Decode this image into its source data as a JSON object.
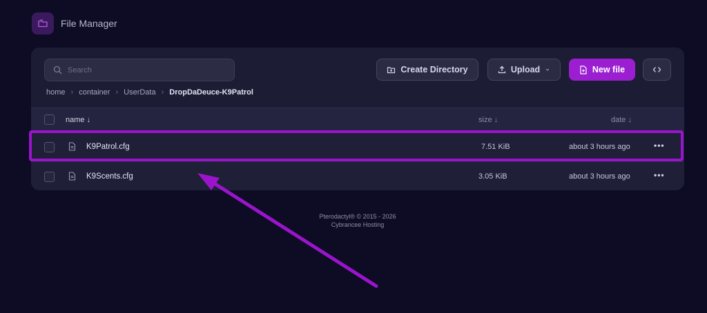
{
  "header": {
    "title": "File Manager",
    "icon": "folder-icon"
  },
  "search": {
    "placeholder": "Search",
    "value": ""
  },
  "toolbar": {
    "create_directory_label": "Create Directory",
    "upload_label": "Upload",
    "new_file_label": "New file"
  },
  "breadcrumb": {
    "items": [
      "home",
      "container",
      "UserData"
    ],
    "current": "DropDaDeuce-K9Patrol"
  },
  "table": {
    "columns": {
      "name": "name ↓",
      "size": "size ↓",
      "date": "date ↓"
    },
    "rows": [
      {
        "name": "K9Patrol.cfg",
        "size": "7.51 KiB",
        "date": "about 3 hours ago"
      },
      {
        "name": "K9Scents.cfg",
        "size": "3.05 KiB",
        "date": "about 3 hours ago"
      }
    ]
  },
  "footer": {
    "line1": "Pterodactyl® © 2015 - 2026",
    "line2": "Cybrancee Hosting"
  },
  "colors": {
    "accent": "#9b1fd1",
    "highlight": "#9a14cc",
    "background": "#0d0c24",
    "panel": "#1c1c34"
  }
}
